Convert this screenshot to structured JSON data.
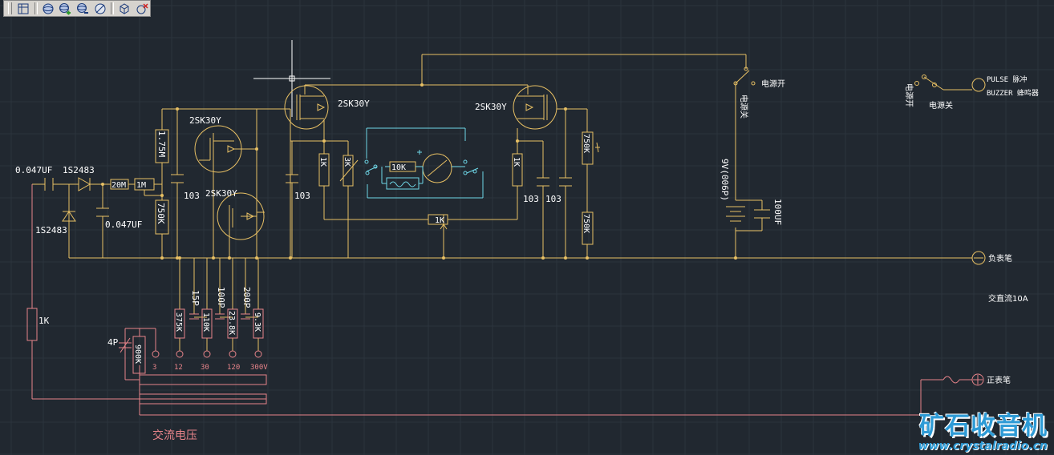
{
  "toolbar": {
    "buttons": [
      "viewport-icon",
      "orbit-icon",
      "orbit-add-icon",
      "orbit-remove-icon",
      "no-orbit-icon",
      "box-icon",
      "box-delete-icon"
    ]
  },
  "colors": {
    "background": "#212830",
    "circuit": "#e8c064",
    "meter": "#e8848a",
    "switchwire": "#6fd8e8",
    "text": "#ffffff",
    "watermark": "#2e9bd6"
  },
  "labels": {
    "q1": "2SK30Y",
    "q2": "2SK30Y",
    "q3": "2SK30Y",
    "q4": "2SK30Y",
    "c_in": "0.047UF",
    "d1": "1S2483",
    "d2": "1S2483",
    "c_047": "0.047UF",
    "r20m": "20M",
    "r1m": "1M",
    "r175": "1.75M",
    "r750a": "750K",
    "c103a": "103",
    "c103b": "103",
    "c103c": "103",
    "c103d": "103",
    "r1ka": "1K",
    "r3k": "3K",
    "r10k": "10K",
    "r1kb": "1K",
    "r1k_pot": "1K",
    "r750b": "750K",
    "r750c": "750K",
    "bat": "9V(006P)",
    "c100uf": "100UF",
    "sw_on": "电源开",
    "sw_off": "电源关",
    "sw_on_v": "电源开",
    "sw_off_v": "电源关",
    "pulse": "PULSE 脉冲",
    "buzzer": "BUZZER 蜂鸣器",
    "neg_probe": "负表笔",
    "pos_probe": "正表笔",
    "acdc": "交直流10A",
    "r1k_m": "1K",
    "c4p": "4P",
    "r900k": "900K",
    "c15p": "15P",
    "c100p": "100P",
    "c200p": "200P",
    "r375k": "375K",
    "r110k": "110K",
    "r238k": "23.8K",
    "r93k": "9.3K",
    "t3": "3",
    "t12": "12",
    "t30": "30",
    "t120": "120",
    "t300": "300V",
    "ac_volt": "交流电压"
  },
  "watermark": {
    "cn": "矿石收音机",
    "url": "www.crystalradio.cn"
  }
}
